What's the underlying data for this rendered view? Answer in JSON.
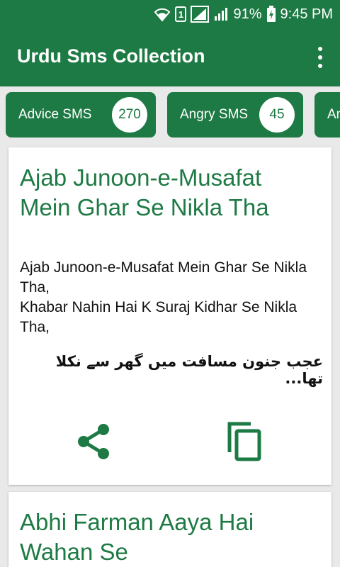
{
  "status_bar": {
    "sim_label": "1",
    "battery_percent": "91%",
    "time": "9:45 PM"
  },
  "app_bar": {
    "title": "Urdu Sms Collection"
  },
  "categories": [
    {
      "label": "Advice SMS",
      "count": "270"
    },
    {
      "label": "Angry SMS",
      "count": "45"
    },
    {
      "label": "An",
      "count": ""
    }
  ],
  "cards": [
    {
      "title": "Ajab Junoon-e-Musafat Mein Ghar Se Nikla Tha",
      "body": "Ajab Junoon-e-Musafat Mein Ghar Se Nikla Tha,\nKhabar Nahin Hai K Suraj Kidhar Se Nikla Tha,",
      "urdu": "عجب جنون مسافت میں گھر سے نکلا تھا..."
    },
    {
      "title": "Abhi Farman Aaya Hai Wahan Se"
    }
  ],
  "colors": {
    "primary": "#1e7a44",
    "background": "#e9e9e9"
  }
}
